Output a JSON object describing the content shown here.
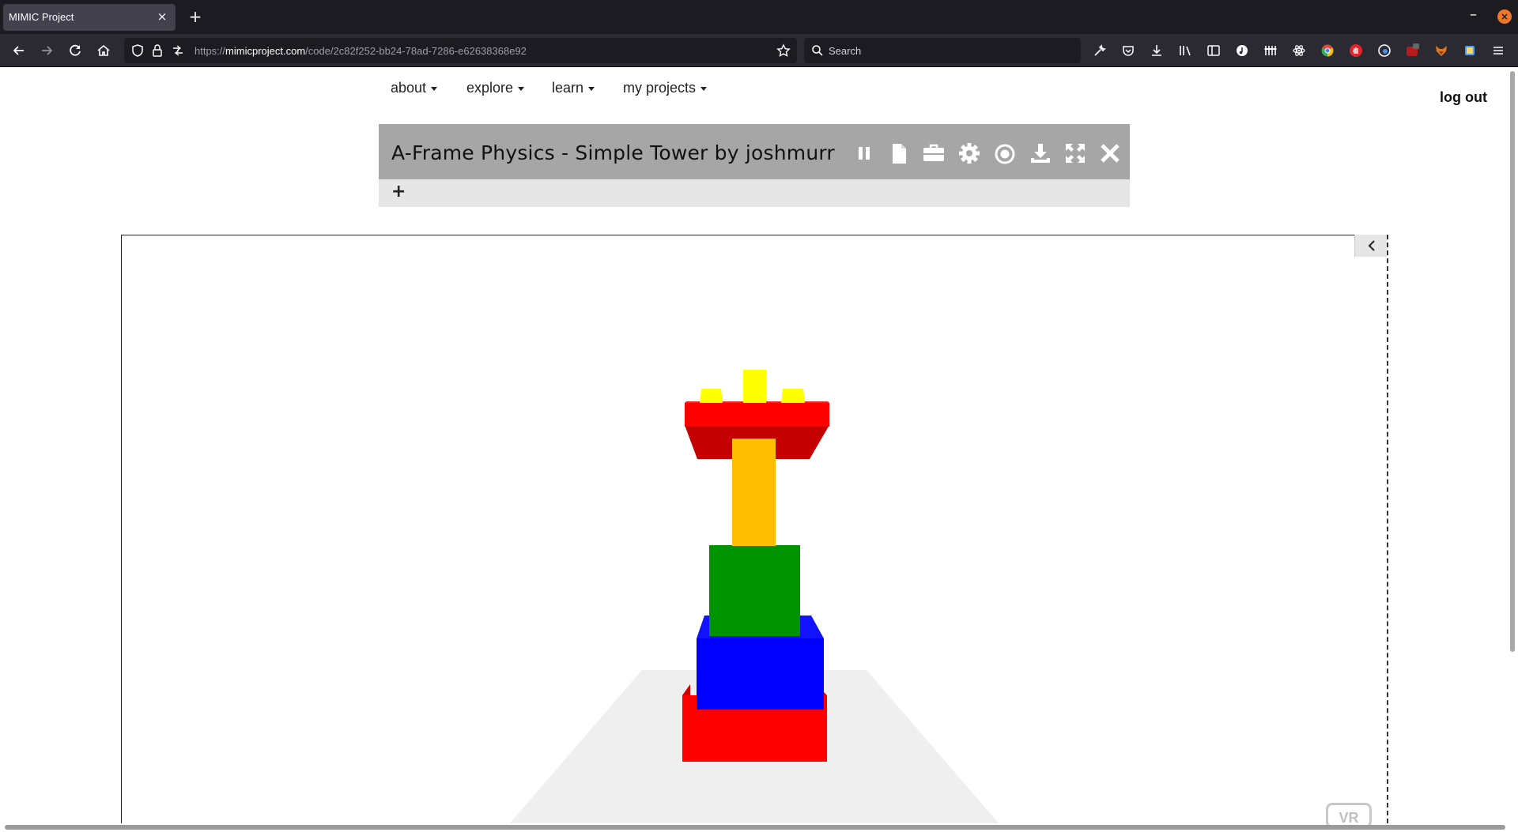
{
  "browser": {
    "tab_title": "MIMIC Project",
    "tab_close": "×",
    "new_tab": "+",
    "url_host": "mimicproject.com",
    "url_scheme": "https://",
    "url_path": "/code/2c82f252-bb24-78ad-7286-e62638368e92",
    "search_placeholder": "Search",
    "minimize": "–",
    "close": "×"
  },
  "site_nav": {
    "items": [
      {
        "label": "about"
      },
      {
        "label": "explore"
      },
      {
        "label": "learn"
      },
      {
        "label": "my projects"
      }
    ],
    "logout": "log out"
  },
  "project": {
    "title": "A-Frame Physics - Simple Tower by joshmurr",
    "add_label": "+",
    "tools": [
      "pause-icon",
      "document-icon",
      "briefcase-icon",
      "gear-icon",
      "record-icon",
      "download-icon",
      "fullscreen-icon",
      "close-icon"
    ]
  },
  "scene": {
    "vr_label": "VR",
    "colors": {
      "red": "#ff0000",
      "dark_red": "#c40000",
      "blue": "#0000ff",
      "green": "#009300",
      "orange": "#ffbf00",
      "yellow": "#ffff00",
      "ground": "#efefef"
    }
  }
}
